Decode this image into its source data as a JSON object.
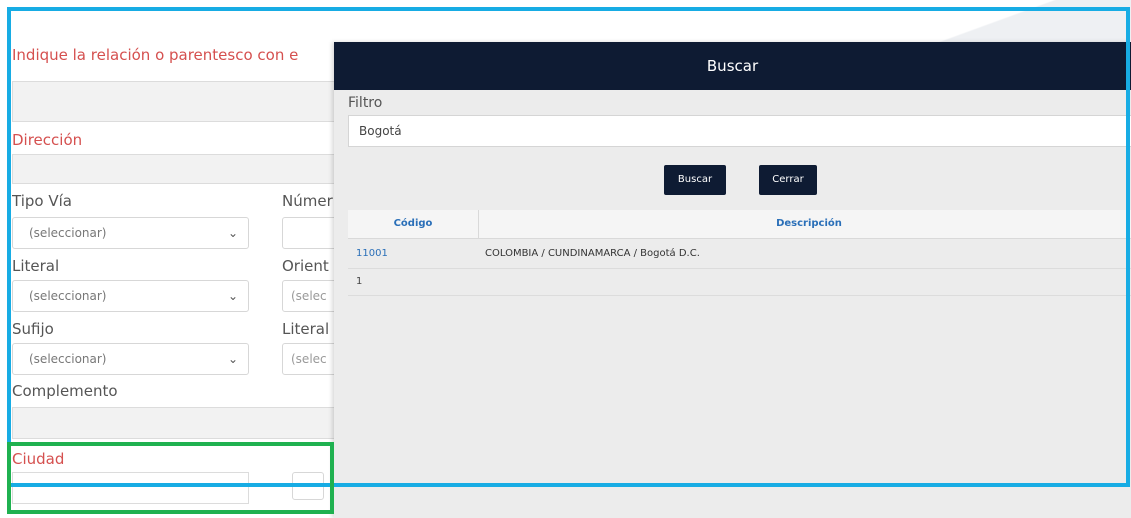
{
  "form": {
    "relacion_label": "Indique la relación o parentesco con e",
    "direccion_label": "Dirección",
    "tipo_via_label": "Tipo Vía",
    "numero_label": "Númer",
    "literal_label": "Literal",
    "orientacion_label": "Orient",
    "sufijo_label": "Sufijo",
    "literal2_label": "Literal",
    "complemento_label": "Complemento",
    "ciudad_label": "Ciudad",
    "select_placeholder": "(seleccionar)",
    "select_partial": "(selec"
  },
  "modal": {
    "title": "Buscar",
    "filtro_label": "Filtro",
    "filtro_value": "Bogotá",
    "buscar_button": "Buscar",
    "cerrar_button": "Cerrar",
    "table": {
      "headers": [
        "Código",
        "Descripción"
      ],
      "rows": [
        {
          "codigo": "11001",
          "descripcion": "COLOMBIA / CUNDINAMARCA / Bogotá D.C."
        }
      ],
      "pager": "1"
    }
  },
  "colors": {
    "highlight_blue": "#17ace4",
    "highlight_green": "#1fb150",
    "modal_header": "#0e1b33",
    "label_red": "#d5504f"
  }
}
